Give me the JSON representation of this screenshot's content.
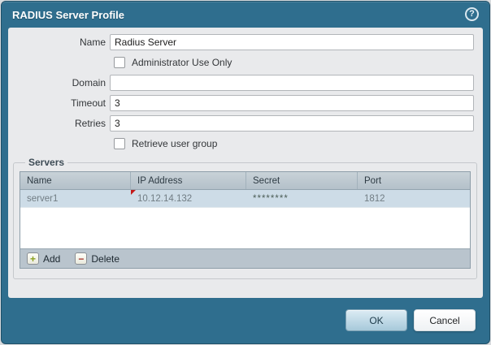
{
  "dialog": {
    "title": "RADIUS Server Profile",
    "help_icon_glyph": "?"
  },
  "colors": {
    "titlebar_teal": "#2f6e8e",
    "content_bg": "#e9eaec",
    "selected_row_blue": "#cddce7",
    "table_header_gray": "#bcc8d0",
    "add_icon_green": "#8ba01e",
    "delete_icon_red": "#a8342a",
    "dirty_cell_red": "#c41a1a",
    "ok_button_blue": "#a7c9da"
  },
  "form": {
    "name_label": "Name",
    "name_value": "Radius Server",
    "admin_only_label": "Administrator Use Only",
    "domain_label": "Domain",
    "domain_value": "",
    "timeout_label": "Timeout",
    "timeout_value": "3",
    "retries_label": "Retries",
    "retries_value": "3",
    "retrieve_group_label": "Retrieve user group"
  },
  "servers": {
    "legend": "Servers",
    "columns": [
      "Name",
      "IP Address",
      "Secret",
      "Port"
    ],
    "rows": [
      [
        "server1",
        "10.12.14.132",
        "********",
        "1812"
      ]
    ],
    "add_icon": "+",
    "add_label": "Add",
    "delete_icon": "−",
    "delete_label": "Delete"
  },
  "footer": {
    "ok_label": "OK",
    "cancel_label": "Cancel"
  }
}
